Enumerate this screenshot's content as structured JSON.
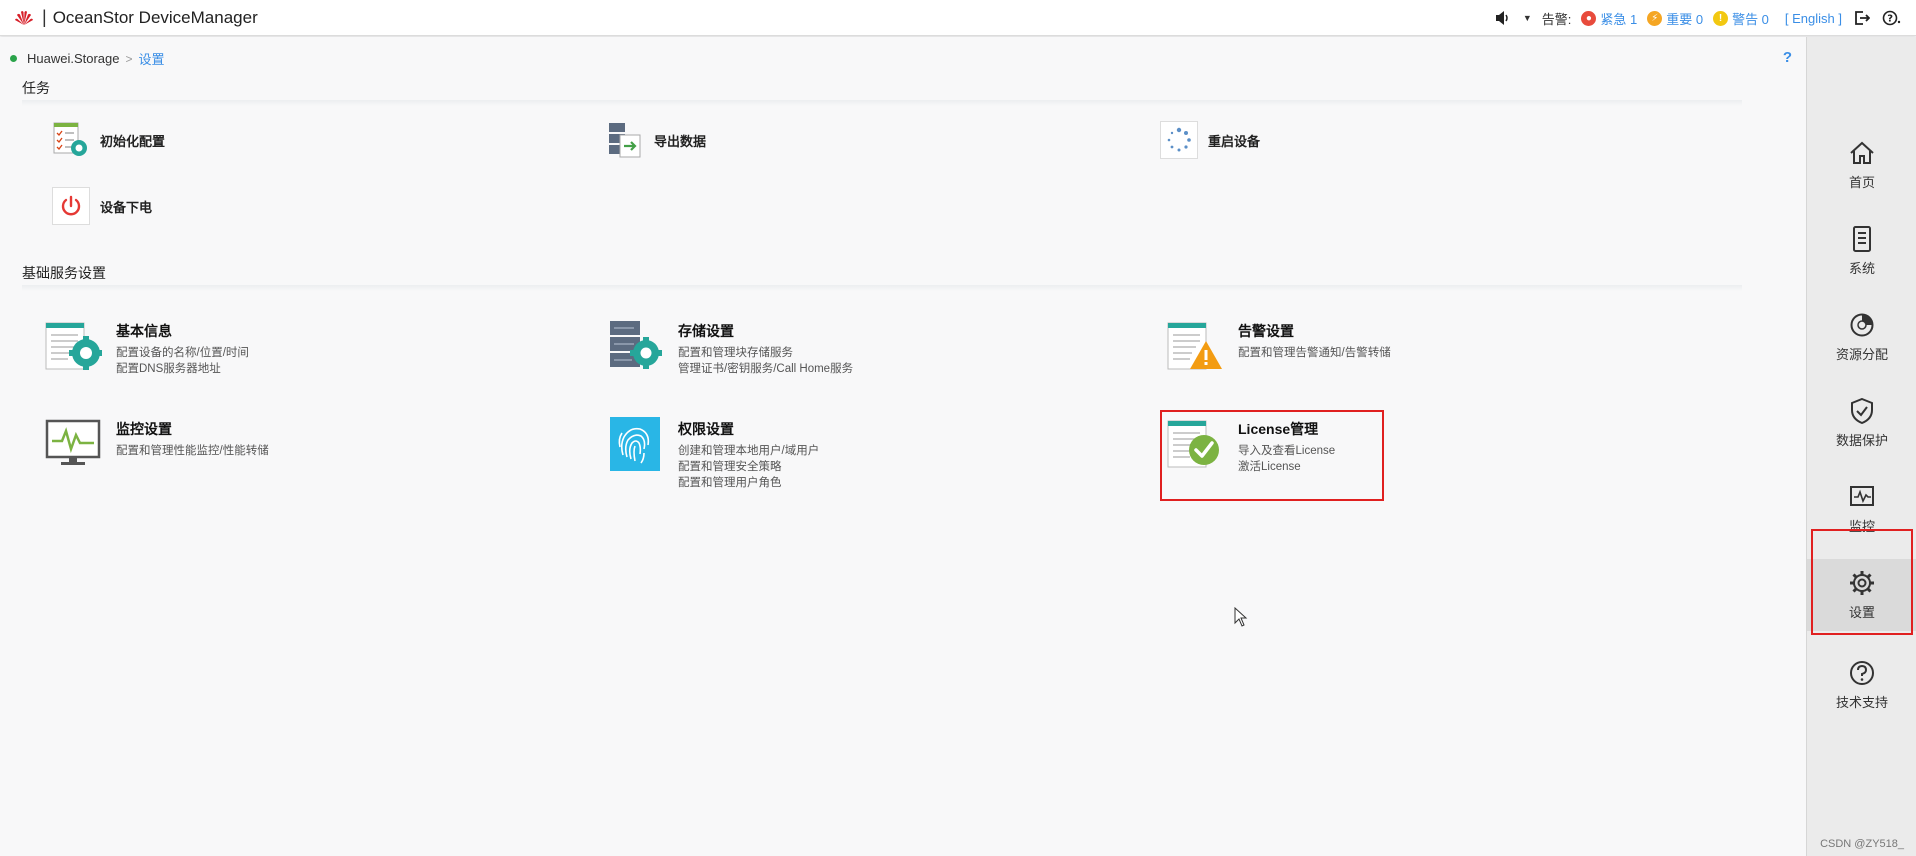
{
  "header": {
    "brand": "HUAWEI",
    "separator": "|",
    "title": "OceanStor DeviceManager",
    "alarm_label": "告警:",
    "alarms": [
      {
        "label": "紧急 1",
        "color": "#e84b3c"
      },
      {
        "label": "重要 0",
        "color": "#f5a623"
      },
      {
        "label": "警告 0",
        "color": "#f2c811"
      }
    ],
    "language": "[ English ]"
  },
  "breadcrumb": {
    "device": "Huawei.Storage",
    "separator": ">",
    "current": "设置"
  },
  "help": "?",
  "tasks_section": {
    "title": "任务",
    "items": [
      {
        "label": "初始化配置",
        "icon": "init-config-icon"
      },
      {
        "label": "导出数据",
        "icon": "export-data-icon"
      },
      {
        "label": "重启设备",
        "icon": "restart-icon"
      },
      {
        "label": "设备下电",
        "icon": "power-off-icon"
      }
    ]
  },
  "services_section": {
    "title": "基础服务设置",
    "items": [
      {
        "title": "基本信息",
        "desc1": "配置设备的名称/位置/时间",
        "desc2": "配置DNS服务器地址",
        "desc3": ""
      },
      {
        "title": "存储设置",
        "desc1": "配置和管理块存储服务",
        "desc2": "管理证书/密钥服务/Call Home服务",
        "desc3": ""
      },
      {
        "title": "告警设置",
        "desc1": "配置和管理告警通知/告警转储",
        "desc2": "",
        "desc3": ""
      },
      {
        "title": "监控设置",
        "desc1": "配置和管理性能监控/性能转储",
        "desc2": "",
        "desc3": ""
      },
      {
        "title": "权限设置",
        "desc1": "创建和管理本地用户/域用户",
        "desc2": "配置和管理安全策略",
        "desc3": "配置和管理用户角色"
      },
      {
        "title": "License管理",
        "desc1": "导入及查看License",
        "desc2": "激活License",
        "desc3": ""
      }
    ]
  },
  "sidebar": {
    "items": [
      {
        "label": "首页",
        "icon": "home-icon"
      },
      {
        "label": "系统",
        "icon": "system-icon"
      },
      {
        "label": "资源分配",
        "icon": "resource-icon"
      },
      {
        "label": "数据保护",
        "icon": "shield-icon"
      },
      {
        "label": "监控",
        "icon": "monitor-icon"
      },
      {
        "label": "设置",
        "icon": "gear-icon"
      },
      {
        "label": "技术支持",
        "icon": "support-icon"
      }
    ],
    "active_index": 5
  },
  "watermark": "CSDN @ZY518_"
}
